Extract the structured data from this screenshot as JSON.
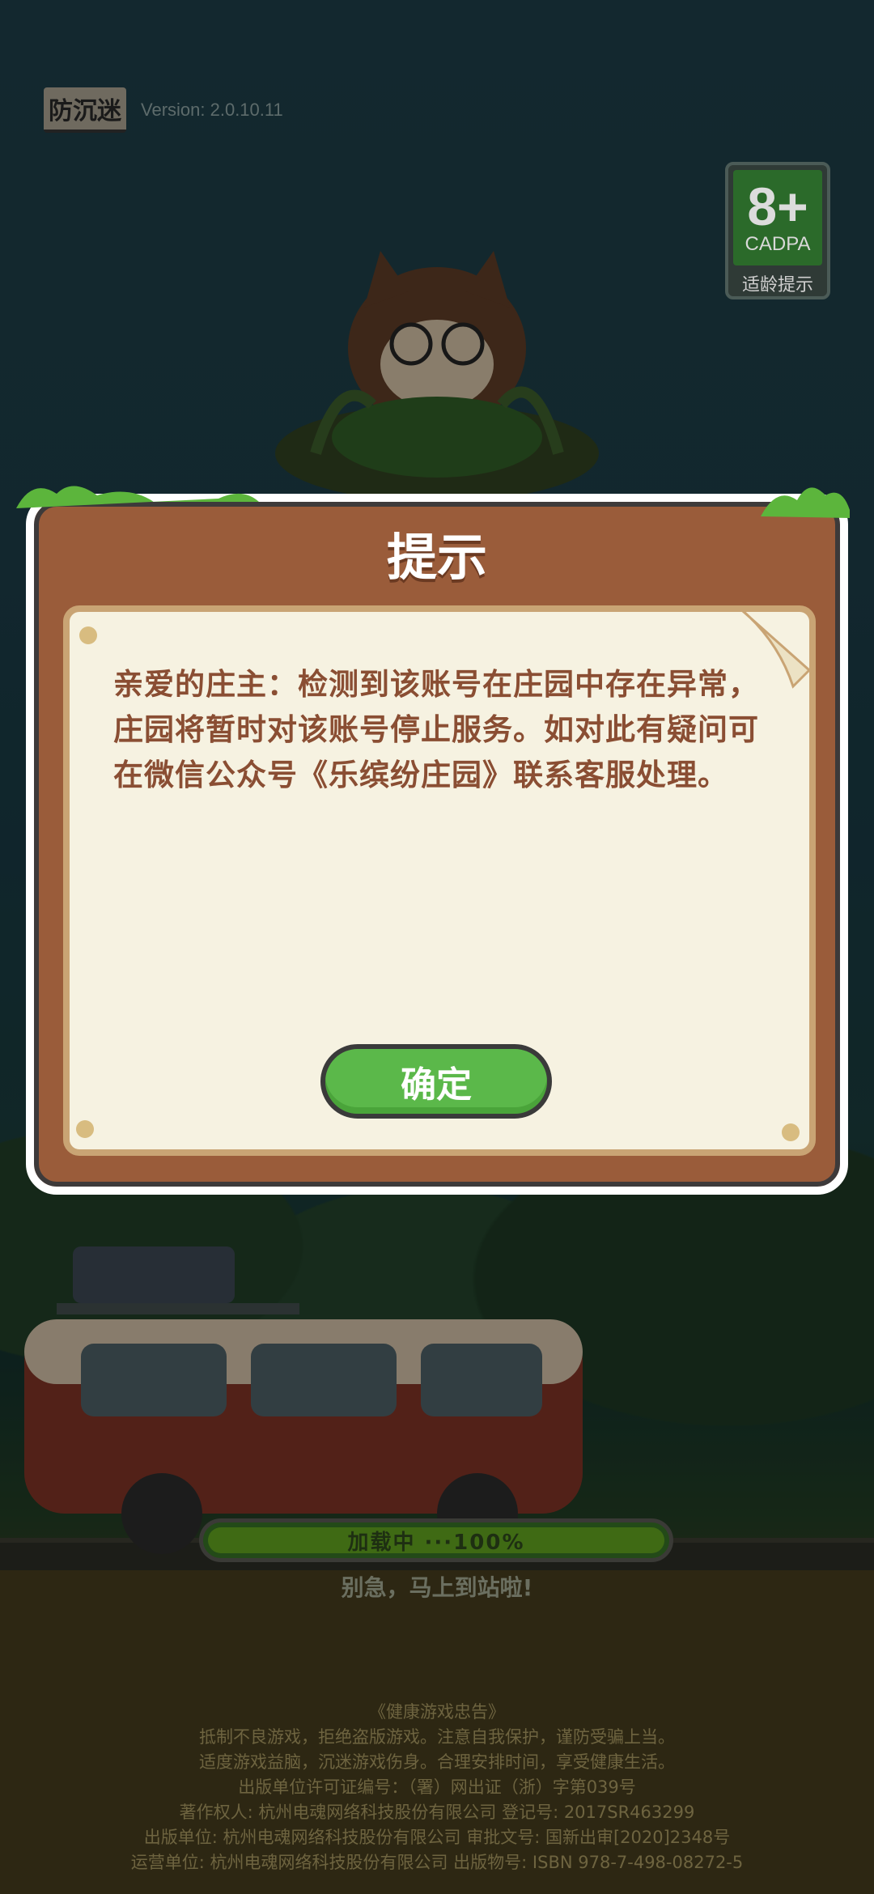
{
  "header": {
    "anti_addiction_badge": "防沉迷",
    "version": "Version: 2.0.10.11"
  },
  "age_rating": {
    "number": "8+",
    "org": "CADPA",
    "caption": "适龄提示"
  },
  "dialog": {
    "title": "提示",
    "message": "亲爱的庄主：检测到该账号在庄园中存在异常，庄园将暂时对该账号停止服务。如对此有疑问可在微信公众号《乐缤纷庄园》联系客服处理。",
    "confirm_label": "确定"
  },
  "loading": {
    "label": "加载中 ···100%",
    "progress": 1.0,
    "subtitle": "别急，马上到站啦!"
  },
  "footer": {
    "lines": [
      "《健康游戏忠告》",
      "抵制不良游戏，拒绝盗版游戏。注意自我保护，谨防受骗上当。",
      "适度游戏益脑，沉迷游戏伤身。合理安排时间，享受健康生活。",
      "出版单位许可证编号：（署）网出证（浙）字第039号",
      "著作权人: 杭州电魂网络科技股份有限公司 登记号: 2017SR463299",
      "出版单位: 杭州电魂网络科技股份有限公司 审批文号: 国新出审[2020]2348号",
      "运营单位: 杭州电魂网络科技股份有限公司 出版物号: ISBN 978-7-498-08272-5"
    ]
  },
  "colors": {
    "dialog_wood": "#9a5c3a",
    "paper": "#f6f2e1",
    "message_text": "#8a4e33",
    "confirm_green": "#5bb84a"
  }
}
